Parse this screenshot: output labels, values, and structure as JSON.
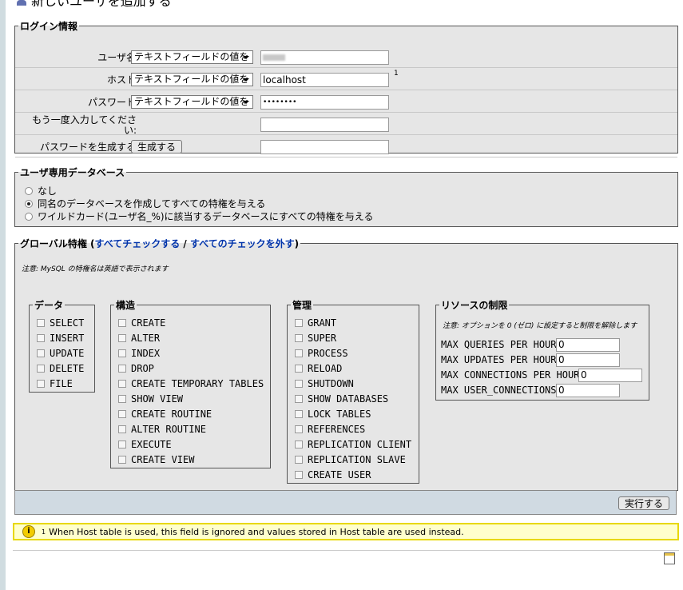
{
  "page_title": "新しいユーザを追加する",
  "login": {
    "legend": "ログイン情報",
    "select_value": "テキストフィールドの値を",
    "rows": [
      {
        "label": "ユーザ名:",
        "value": ""
      },
      {
        "label": "ホスト:",
        "value": "localhost",
        "sup": "1"
      },
      {
        "label": "パスワード:",
        "value": "••••••••"
      },
      {
        "label": "もう一度入力してください:",
        "value": ""
      },
      {
        "label": "パスワードを生成する:",
        "button": "生成する",
        "value": ""
      }
    ]
  },
  "userdb": {
    "legend": "ユーザ専用データベース",
    "options": [
      {
        "label": "なし",
        "checked": false
      },
      {
        "label": "同名のデータベースを作成してすべての特権を与える",
        "checked": true
      },
      {
        "label": "ワイルドカード(ユーザ名_%)に該当するデータベースにすべての特権を与える",
        "checked": false
      }
    ]
  },
  "global": {
    "legend_prefix": "グローバル特権 (",
    "check_all": "すべてチェックする",
    "sep": " / ",
    "uncheck_all": "すべてのチェックを外す",
    "legend_suffix": ")",
    "note": "注意: MySQL の特権名は英語で表示されます",
    "data": {
      "legend": "データ",
      "items": [
        "SELECT",
        "INSERT",
        "UPDATE",
        "DELETE",
        "FILE"
      ]
    },
    "structure": {
      "legend": "構造",
      "items": [
        "CREATE",
        "ALTER",
        "INDEX",
        "DROP",
        "CREATE TEMPORARY TABLES",
        "SHOW VIEW",
        "CREATE ROUTINE",
        "ALTER ROUTINE",
        "EXECUTE",
        "CREATE VIEW"
      ]
    },
    "admin": {
      "legend": "管理",
      "items": [
        "GRANT",
        "SUPER",
        "PROCESS",
        "RELOAD",
        "SHUTDOWN",
        "SHOW DATABASES",
        "LOCK TABLES",
        "REFERENCES",
        "REPLICATION CLIENT",
        "REPLICATION SLAVE",
        "CREATE USER"
      ]
    },
    "limits": {
      "legend": "リソースの制限",
      "note": "注意: オプションを 0 (ゼロ) に設定すると制限を解除します",
      "items": [
        {
          "label": "MAX QUERIES PER HOUR",
          "value": "0"
        },
        {
          "label": "MAX UPDATES PER HOUR",
          "value": "0"
        },
        {
          "label": "MAX CONNECTIONS PER HOUR",
          "value": "0"
        },
        {
          "label": "MAX USER_CONNECTIONS",
          "value": "0"
        }
      ]
    }
  },
  "submit_label": "実行する",
  "footnote": {
    "sup": "1",
    "text": "When Host table is used, this field is ignored and values stored in Host table are used instead."
  }
}
